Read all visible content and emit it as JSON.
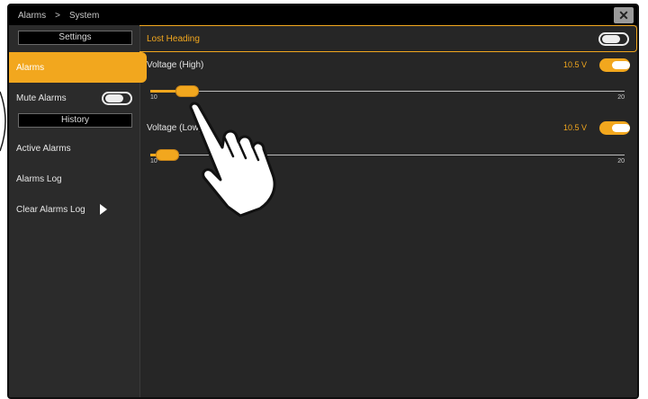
{
  "breadcrumb": {
    "part1": "Alarms",
    "separator": ">",
    "part2": "System"
  },
  "close_label": "✕",
  "sidebar": {
    "settings_header": "Settings",
    "alarms": "Alarms",
    "mute_alarms": "Mute Alarms",
    "mute_alarms_on": false,
    "history_header": "History",
    "active_alarms": "Active Alarms",
    "alarms_log": "Alarms Log",
    "clear_alarms_log": "Clear Alarms Log"
  },
  "main": {
    "lost_heading": {
      "label": "Lost Heading",
      "enabled": false
    },
    "voltage_high": {
      "label": "Voltage (High)",
      "value": "10.5 V",
      "enabled": true,
      "slider_min": "10",
      "slider_max": "20"
    },
    "voltage_low": {
      "label": "Voltage (Low)",
      "value": "10.5 V",
      "enabled": true,
      "slider_min": "10",
      "slider_max": "20"
    }
  },
  "colors": {
    "accent": "#f2a71e",
    "background": "#262626",
    "topbar": "#000000"
  },
  "icons": {
    "close": "close-icon",
    "arrow": "chevron-right-icon",
    "hand": "pointing-hand-icon"
  }
}
